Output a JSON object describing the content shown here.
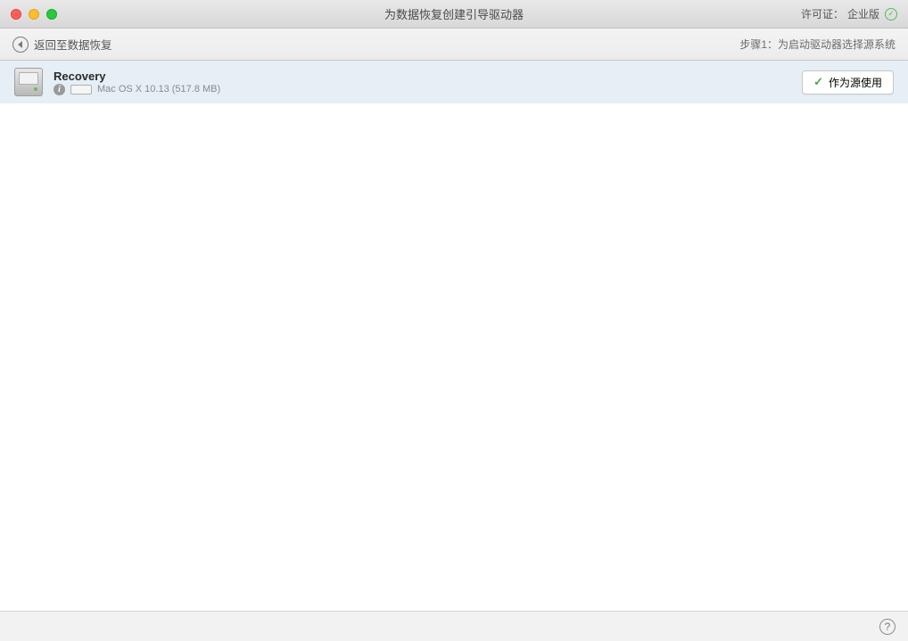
{
  "titlebar": {
    "title": "为数据恢复创建引导驱动器",
    "license_label": "许可证：",
    "license_value": "企业版"
  },
  "subbar": {
    "back_label": "返回至数据恢复",
    "step_text": "步骤1：为启动驱动器选择源系统"
  },
  "rows": [
    {
      "name": "Recovery",
      "meta": "Mac OS X 10.13 (517.8 MB)",
      "action_label": "作为源使用"
    }
  ],
  "footer": {
    "help_tooltip": "帮助"
  }
}
